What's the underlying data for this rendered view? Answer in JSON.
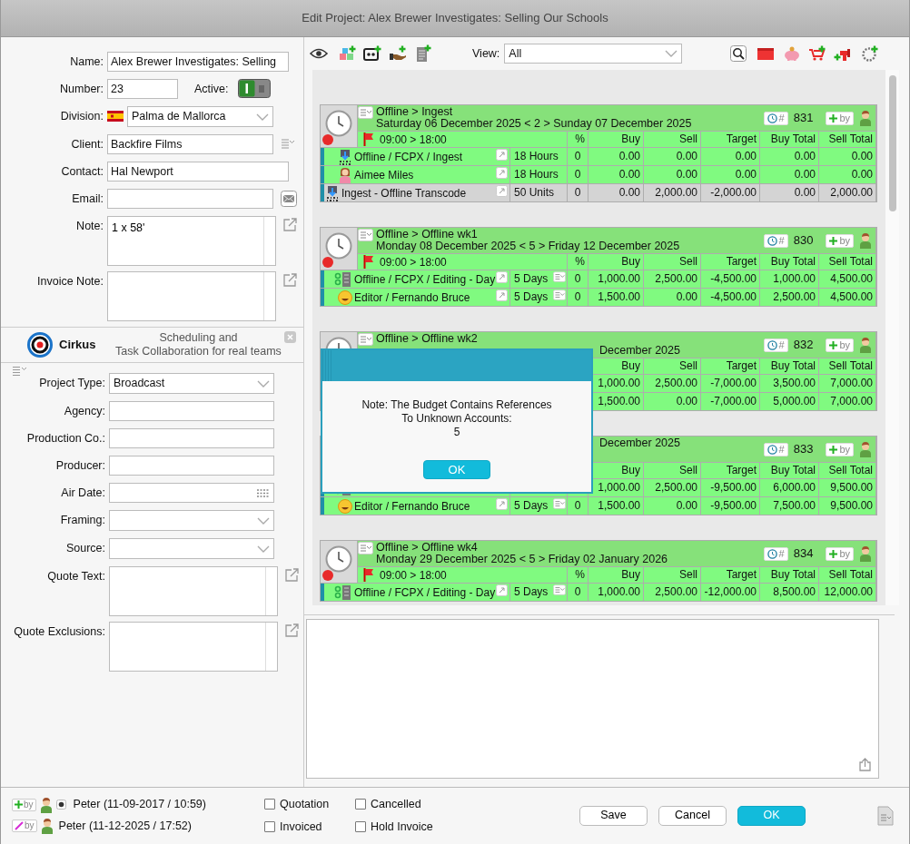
{
  "window": {
    "title": "Edit Project: Alex Brewer Investigates: Selling Our Schools"
  },
  "project": {
    "fields": [
      {
        "kind": "text",
        "label": "Name:",
        "value": "Alex Brewer Investigates: Selling"
      },
      {
        "kind": "number",
        "label": "Number:",
        "value": "23",
        "toggle_label": "Active:",
        "on": true
      },
      {
        "kind": "division",
        "label": "Division:",
        "value": "Palma de Mallorca"
      },
      {
        "kind": "text",
        "label": "Client:",
        "value": "Backfire Films",
        "action": {
          "kind": "menu"
        }
      },
      {
        "kind": "text",
        "label": "Contact:",
        "value": "Hal Newport"
      },
      {
        "kind": "text",
        "label": "Email:",
        "action": {
          "kind": "mail"
        }
      },
      {
        "kind": "area",
        "label": "Note:",
        "value": "1 x 58'",
        "action": {
          "kind": "open"
        }
      },
      {
        "kind": "area",
        "label": "Invoice Note:",
        "action": {
          "kind": "open"
        }
      }
    ]
  },
  "promo": {
    "brand": "Cirkus",
    "tagline": "Scheduling and\nTask Collaboration for real teams"
  },
  "details": {
    "fields": [
      {
        "kind": "select",
        "label": "Project Type:",
        "value": "Broadcast"
      },
      {
        "kind": "text",
        "label": "Agency:"
      },
      {
        "kind": "text",
        "label": "Production Co.:"
      },
      {
        "kind": "text",
        "label": "Producer:"
      },
      {
        "kind": "date",
        "label": "Air Date:"
      },
      {
        "kind": "select",
        "label": "Framing:"
      },
      {
        "kind": "select",
        "label": "Source:"
      },
      {
        "kind": "area",
        "label": "Quote Text:",
        "action": {
          "kind": "open"
        }
      },
      {
        "kind": "area",
        "label": "Quote Exclusions:",
        "action": {
          "kind": "open"
        }
      }
    ]
  },
  "toolbar": {
    "view_label": "View:",
    "view_value": "All"
  },
  "bookings": [
    {
      "title": "Offline > Ingest",
      "dates": "Saturday 06 December 2025 < 2 > Sunday 07 December 2025",
      "ref_badge": "#",
      "number": "831",
      "by_badge": "by",
      "time": "09:00 > 18:00",
      "covered": false,
      "columns": [
        "%",
        "Buy",
        "Sell",
        "Target",
        "Buy Total",
        "Sell Total"
      ],
      "rows": [
        {
          "kind": "transcode",
          "name": "Offline / FCPX / Ingest",
          "qty": "18 Hours",
          "notes": false,
          "values": [
            "0",
            "0.00",
            "0.00",
            "0.00",
            "0.00",
            "0.00"
          ]
        },
        {
          "kind": "woman",
          "name": "Aimee Miles",
          "qty": "18 Hours",
          "notes": false,
          "values": [
            "0",
            "0.00",
            "0.00",
            "0.00",
            "0.00",
            "0.00"
          ]
        },
        {
          "kind": "unit",
          "name": "Ingest - Offline Transcode",
          "qty": "50 Units",
          "notes": false,
          "values": [
            "0",
            "0.00",
            "2,000.00",
            "-2,000.00",
            "0.00",
            "2,000.00"
          ]
        }
      ]
    },
    {
      "title": "Offline > Offline wk1",
      "dates": "Monday 08 December 2025 < 5 > Friday 12 December 2025",
      "ref_badge": "#",
      "number": "830",
      "by_badge": "by",
      "time": "09:00 > 18:00",
      "covered": false,
      "columns": [
        "%",
        "Buy",
        "Sell",
        "Target",
        "Buy Total",
        "Sell Total"
      ],
      "rows": [
        {
          "kind": "suite",
          "name": "Offline / FCPX / Editing - Day",
          "qty": "5 Days",
          "notes": true,
          "values": [
            "0",
            "1,000.00",
            "2,500.00",
            "-4,500.00",
            "1,000.00",
            "4,500.00"
          ]
        },
        {
          "kind": "smiley",
          "name": "Editor / Fernando Bruce",
          "qty": "5 Days",
          "notes": true,
          "values": [
            "0",
            "1,500.00",
            "0.00",
            "-4,500.00",
            "2,500.00",
            "4,500.00"
          ]
        }
      ]
    },
    {
      "title": "Offline > Offline wk2",
      "dates": "December 2025",
      "ref_badge": "#",
      "number": "832",
      "by_badge": "by",
      "covered": true,
      "columns": [
        "Buy",
        "Sell",
        "Target",
        "Buy Total",
        "Sell Total"
      ],
      "rows": [
        {
          "values": [
            "1,000.00",
            "2,500.00",
            "-7,000.00",
            "3,500.00",
            "7,000.00"
          ]
        },
        {
          "values": [
            "1,500.00",
            "0.00",
            "-7,000.00",
            "5,000.00",
            "7,000.00"
          ]
        }
      ]
    },
    {
      "dates": "December 2025",
      "ref_badge": "#",
      "number": "833",
      "by_badge": "by",
      "covered": true,
      "columns": [
        "Buy",
        "Sell",
        "Target",
        "Buy Total",
        "Sell Total"
      ],
      "rows": [
        {
          "kind": "suite",
          "values": [
            "1,000.00",
            "2,500.00",
            "-9,500.00",
            "6,000.00",
            "9,500.00"
          ]
        },
        {
          "kind": "smiley",
          "name": "Editor / Fernando Bruce",
          "qty": "5 Days",
          "notes": true,
          "values": [
            "0",
            "1,500.00",
            "0.00",
            "-9,500.00",
            "7,500.00",
            "9,500.00"
          ]
        }
      ]
    },
    {
      "title": "Offline > Offline wk4",
      "dates": "Monday 29 December 2025 < 5 > Friday 02 January 2026",
      "ref_badge": "#",
      "number": "834",
      "by_badge": "by",
      "time": "09:00 > 18:00",
      "covered": false,
      "columns": [
        "%",
        "Buy",
        "Sell",
        "Target",
        "Buy Total",
        "Sell Total"
      ],
      "rows": [
        {
          "kind": "suite",
          "name": "Offline / FCPX / Editing - Day",
          "qty": "5 Days",
          "notes": true,
          "values": [
            "0",
            "1,000.00",
            "2,500.00",
            "-12,000.00",
            "8,500.00",
            "12,000.00"
          ]
        }
      ]
    }
  ],
  "dialog": {
    "message": "Note: The Budget Contains References\nTo Unknown Accounts:\n5",
    "button": "OK"
  },
  "footer": {
    "created": {
      "badge": "by",
      "text": "Peter (11-09-2017 / 10:59)"
    },
    "modified": {
      "badge": "by",
      "text": "Peter (11-12-2025 / 17:52)"
    },
    "checks": [
      {
        "label": "Quotation",
        "checked": false
      },
      {
        "label": "Cancelled",
        "checked": false
      },
      {
        "label": "Invoiced",
        "checked": false
      },
      {
        "label": "Hold Invoice",
        "checked": false
      }
    ],
    "buttons": [
      {
        "label": "Save",
        "default": false
      },
      {
        "label": "Cancel",
        "default": false
      },
      {
        "label": "OK",
        "default": true
      }
    ]
  }
}
